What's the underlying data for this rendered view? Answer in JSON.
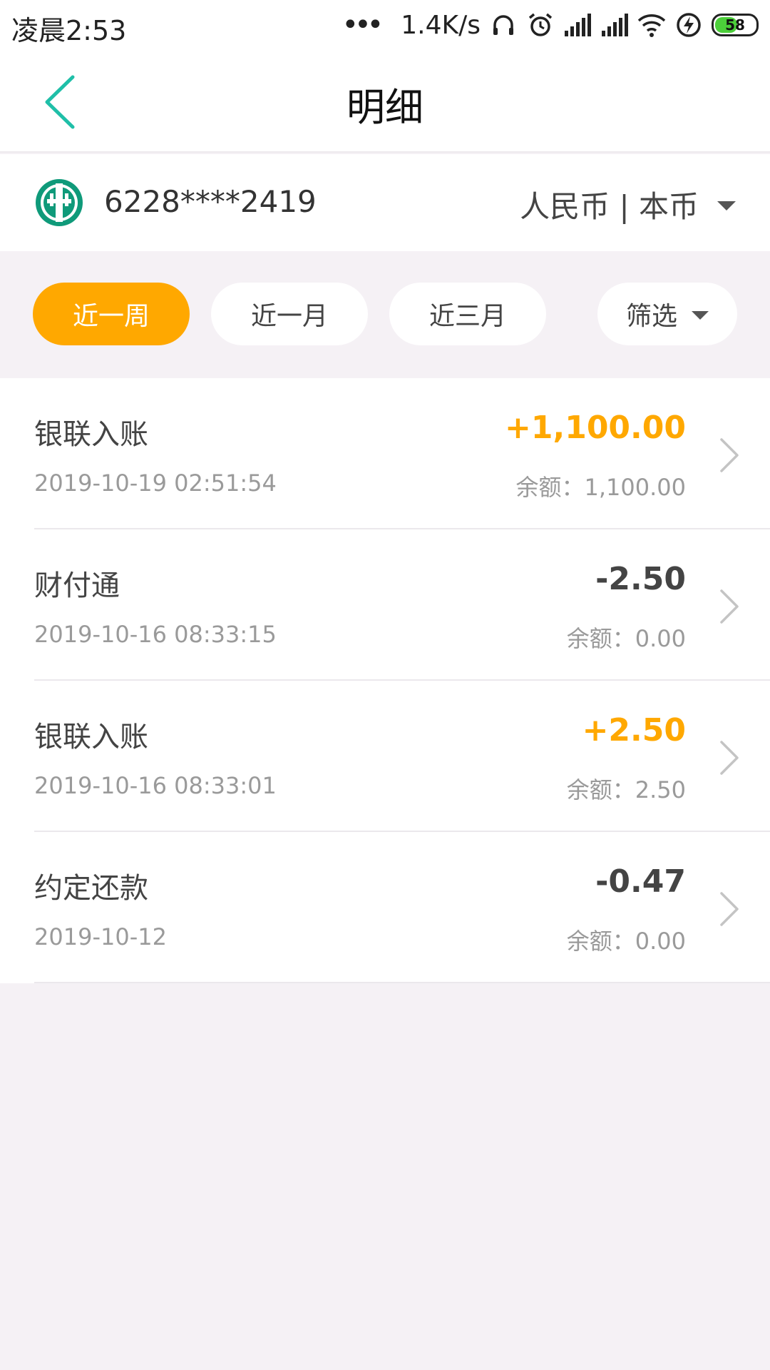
{
  "status_bar": {
    "time": "凌晨2:53",
    "dots": "•••",
    "network_speed": "1.4K/s",
    "battery_level": "58",
    "battery_fraction": 0.58,
    "icons": [
      "headphones-icon",
      "alarm-icon",
      "signal-icon",
      "signal-icon",
      "wifi-icon",
      "charging-icon",
      "battery-icon"
    ]
  },
  "nav": {
    "title": "明细",
    "back_icon": "chevron-left-icon"
  },
  "account": {
    "card_number": "6228****2419",
    "currency": "人民币 | 本币",
    "logo_icon": "bank-logo-icon"
  },
  "filters": {
    "tabs": [
      {
        "label": "近一周",
        "active": true
      },
      {
        "label": "近一月",
        "active": false
      },
      {
        "label": "近三月",
        "active": false
      }
    ],
    "filter_label": "筛选"
  },
  "transactions": [
    {
      "title": "银联入账",
      "time": "2019-10-19 02:51:54",
      "amount": "+1,100.00",
      "type": "income",
      "balance": "余额：1,100.00"
    },
    {
      "title": "财付通",
      "time": "2019-10-16 08:33:15",
      "amount": "-2.50",
      "type": "expense",
      "balance": "余额：0.00"
    },
    {
      "title": "银联入账",
      "time": "2019-10-16 08:33:01",
      "amount": "+2.50",
      "type": "income",
      "balance": "余额：2.50"
    },
    {
      "title": "约定还款",
      "time": "2019-10-12",
      "amount": "-0.47",
      "type": "expense",
      "balance": "余额：0.00"
    }
  ],
  "colors": {
    "accent": "#ffa800",
    "back_arrow": "#1fbfa8",
    "bank_logo": "#0f9a7a",
    "page_bg": "#f5f1f5"
  }
}
